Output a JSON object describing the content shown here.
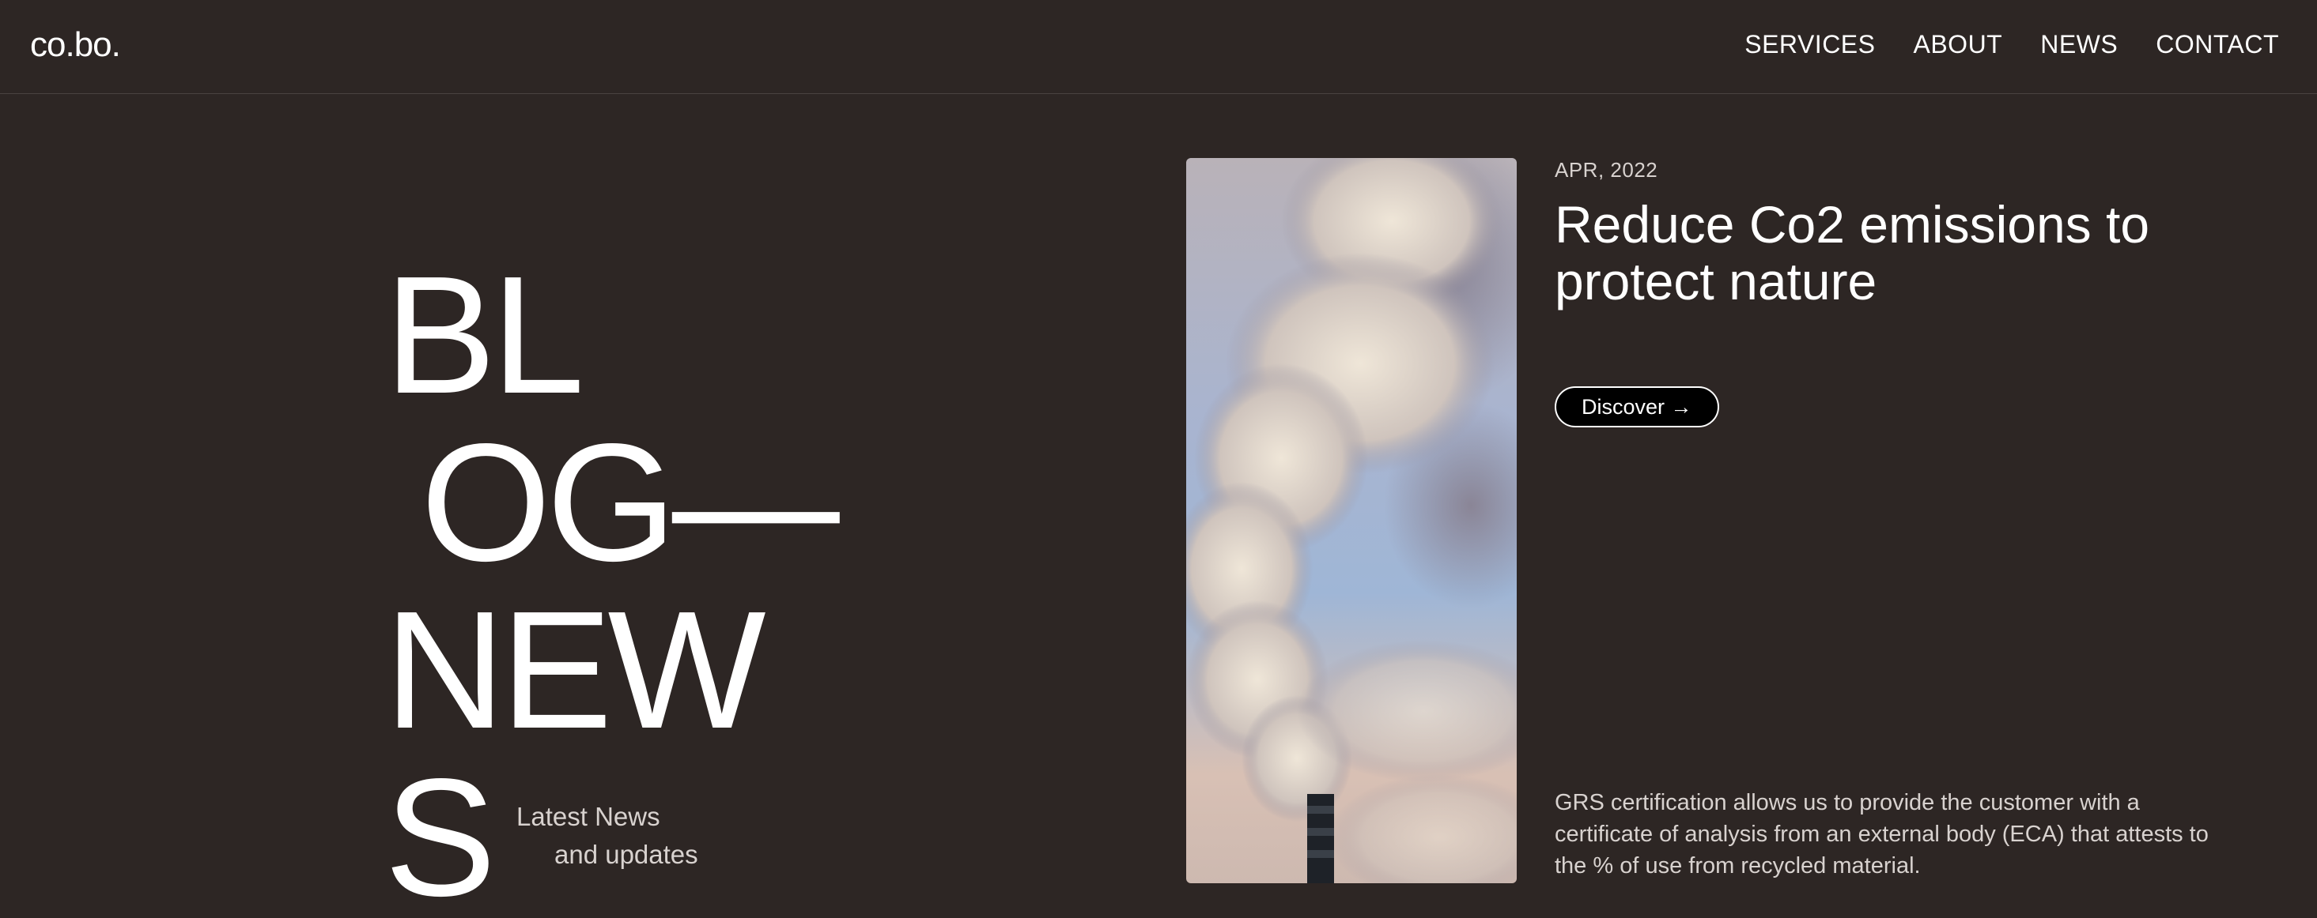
{
  "header": {
    "logo": "co.bo.",
    "nav": [
      {
        "label": "SERVICES"
      },
      {
        "label": "ABOUT"
      },
      {
        "label": "NEWS"
      },
      {
        "label": "CONTACT"
      }
    ]
  },
  "hero": {
    "title_lines": [
      "BL",
      "OG—",
      "NEW",
      "S"
    ],
    "subtitle_line1": "Latest News",
    "subtitle_line2": "and updates"
  },
  "article": {
    "date": "APR, 2022",
    "title": "Reduce Co2 emissions to protect nature",
    "button_label": "Discover →",
    "description": "GRS certification allows us to provide the customer with a certificate of analysis from an external body (ECA) that attests to the % of use from recycled material."
  },
  "colors": {
    "background": "#2d2624",
    "text": "#ffffff",
    "muted_text": "#d8d2cf",
    "button_bg": "#000000"
  }
}
